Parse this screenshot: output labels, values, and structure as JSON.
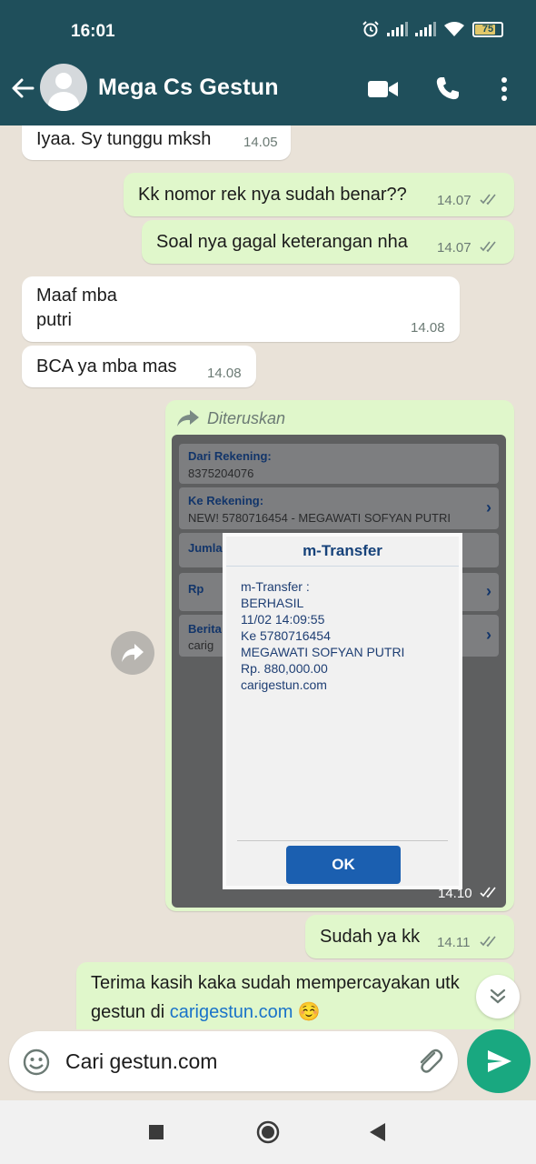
{
  "status_bar": {
    "time": "16:01",
    "battery": "75"
  },
  "header": {
    "contact_name": "Mega Cs Gestun"
  },
  "messages": [
    {
      "direction": "in",
      "text": "Iyaa. Sy tunggu mksh",
      "time": "14.05"
    },
    {
      "direction": "out",
      "text": "Kk nomor rek nya sudah benar??",
      "time": "14.07"
    },
    {
      "direction": "out",
      "text": "Soal nya gagal keterangan nha",
      "time": "14.07"
    },
    {
      "direction": "in",
      "lines": [
        "Maaf mba",
        "putri"
      ],
      "time": "14.08"
    },
    {
      "direction": "in",
      "text": "BCA ya mba mas",
      "time": "14.08"
    },
    {
      "direction": "out",
      "forwarded_label": "Diteruskan",
      "time": "14.10",
      "image": {
        "fields": [
          {
            "label": "Dari Rekening:",
            "value": "8375204076"
          },
          {
            "label": "Ke Rekening:",
            "value": "NEW! 5780716454 - MEGAWATI SOFYAN PUTRI"
          },
          {
            "label": "Jumla"
          },
          {
            "label": "Rp"
          },
          {
            "label": "Berita",
            "value": "carig"
          }
        ],
        "dialog": {
          "title": "m-Transfer",
          "lines": [
            "m-Transfer :",
            "BERHASIL",
            "11/02 14:09:55",
            "Ke 5780716454",
            "MEGAWATI SOFYAN PUTRI",
            "Rp. 880,000.00",
            "carigestun.com"
          ],
          "button": "OK"
        }
      }
    },
    {
      "direction": "out",
      "text": "Sudah ya kk",
      "time": "14.11"
    },
    {
      "direction": "out",
      "line1": "Terima kasih kaka sudah mempercayakan utk",
      "line2_prefix": "gestun di ",
      "line2_link": "carigestun.com",
      "emoji": "☺️"
    }
  ],
  "input": {
    "value": "Cari gestun.com"
  },
  "colors": {
    "header": "#1f4f5b",
    "outgoing": "#e0f7cb",
    "incoming": "#ffffff",
    "send": "#19a880",
    "link": "#1a73c9"
  },
  "icons": [
    "back-arrow-icon",
    "video-call-icon",
    "phone-icon",
    "more-options-icon",
    "forward-icon",
    "emoji-icon",
    "attach-icon",
    "send-icon",
    "scroll-down-icon",
    "nav-recents-icon",
    "nav-home-icon",
    "nav-back-icon"
  ]
}
